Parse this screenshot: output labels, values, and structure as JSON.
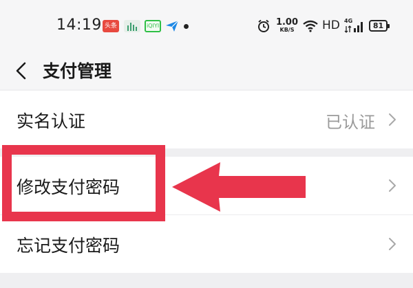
{
  "status_bar": {
    "time": "14:19",
    "app_icons": [
      "toutiao-icon",
      "tree-icon",
      "iqiyi-icon",
      "send-icon"
    ],
    "toutiao_label": "头条",
    "iqiyi_label": "iQIYI",
    "network_speed_value": "1.00",
    "network_speed_unit": "KB/S",
    "hd_label": "HD",
    "network_type": "4G",
    "battery": "81"
  },
  "header": {
    "title": "支付管理"
  },
  "rows": [
    {
      "label": "实名认证",
      "value": "已认证"
    },
    {
      "label": "修改支付密码",
      "value": ""
    },
    {
      "label": "忘记支付密码",
      "value": ""
    }
  ],
  "colors": {
    "annotation": "#e8354c",
    "background": "#efeff1",
    "row_background": "#ffffff",
    "secondary_text": "#9a9a9a"
  }
}
